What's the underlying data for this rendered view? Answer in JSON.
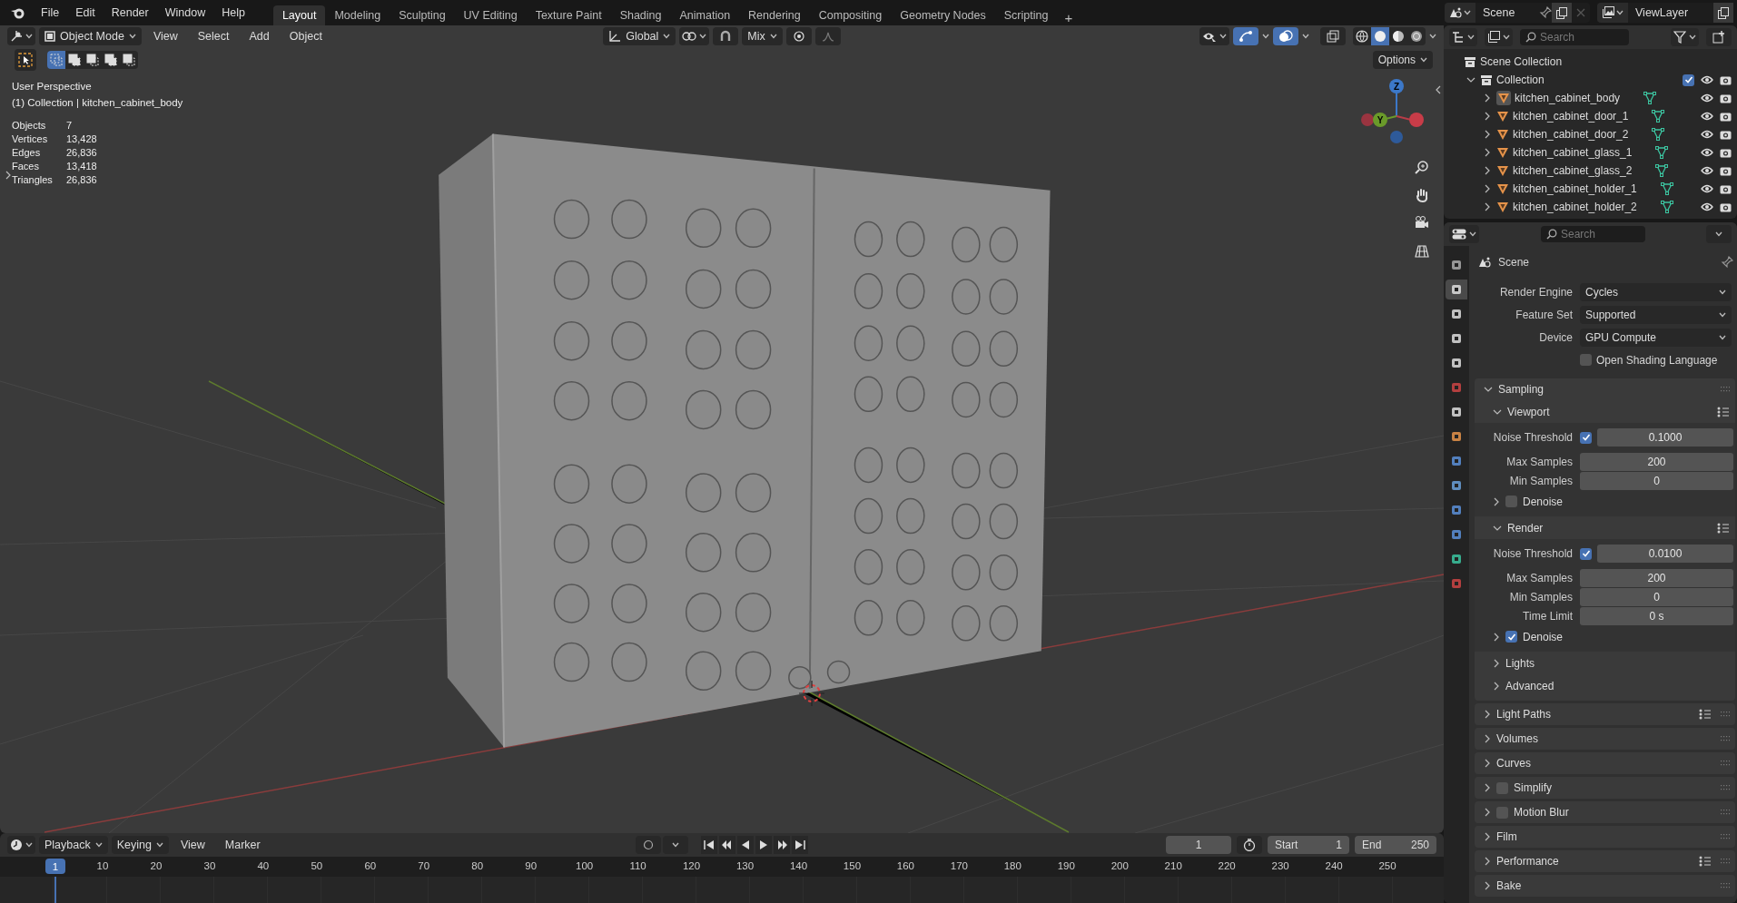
{
  "top_bar": {
    "menus": [
      "File",
      "Edit",
      "Render",
      "Window",
      "Help"
    ],
    "workspaces": [
      {
        "label": "Layout",
        "selected": true
      },
      {
        "label": "Modeling",
        "selected": false
      },
      {
        "label": "Sculpting",
        "selected": false
      },
      {
        "label": "UV Editing",
        "selected": false
      },
      {
        "label": "Texture Paint",
        "selected": false
      },
      {
        "label": "Shading",
        "selected": false
      },
      {
        "label": "Animation",
        "selected": false
      },
      {
        "label": "Rendering",
        "selected": false
      },
      {
        "label": "Compositing",
        "selected": false
      },
      {
        "label": "Geometry Nodes",
        "selected": false
      },
      {
        "label": "Scripting",
        "selected": false
      }
    ],
    "add_workspace": "+",
    "scene": "Scene",
    "view_layer": "ViewLayer"
  },
  "viewport": {
    "header": {
      "mode": "Object Mode",
      "menus": [
        "View",
        "Select",
        "Add",
        "Object"
      ],
      "orientation": "Global",
      "snap_target": "Mix",
      "options": "Options"
    },
    "select_modes": [
      {
        "selected": true
      },
      {
        "selected": false
      },
      {
        "selected": false
      },
      {
        "selected": false
      },
      {
        "selected": false
      }
    ],
    "gizmos_on": true,
    "overlays_on": true,
    "shading_modes": [
      {
        "selected": false
      },
      {
        "selected": true
      },
      {
        "selected": false
      },
      {
        "selected": false
      }
    ],
    "view_name": "User Perspective",
    "active_object": "(1) Collection | kitchen_cabinet_body",
    "statistics": [
      {
        "label": "Objects",
        "value": "7"
      },
      {
        "label": "Vertices",
        "value": "13,428"
      },
      {
        "label": "Edges",
        "value": "26,836"
      },
      {
        "label": "Faces",
        "value": "13,418"
      },
      {
        "label": "Triangles",
        "value": "26,836"
      }
    ],
    "axis_labels": [
      "Z",
      "Y"
    ]
  },
  "outliner": {
    "search_placeholder": "Search",
    "tree": [
      {
        "name": "Scene Collection",
        "kind": "scene_collection",
        "children": [
          {
            "name": "Collection",
            "kind": "collection",
            "expanded": true,
            "included": true,
            "children": [
              {
                "name": "kitchen_cabinet_body",
                "kind": "mesh",
                "expanded": false,
                "active": true
              },
              {
                "name": "kitchen_cabinet_door_1",
                "kind": "mesh",
                "expanded": false,
                "active": false
              },
              {
                "name": "kitchen_cabinet_door_2",
                "kind": "mesh",
                "expanded": false,
                "active": false
              },
              {
                "name": "kitchen_cabinet_glass_1",
                "kind": "mesh",
                "expanded": false,
                "active": false
              },
              {
                "name": "kitchen_cabinet_glass_2",
                "kind": "mesh",
                "expanded": false,
                "active": false
              },
              {
                "name": "kitchen_cabinet_holder_1",
                "kind": "mesh",
                "expanded": false,
                "active": false
              },
              {
                "name": "kitchen_cabinet_holder_2",
                "kind": "mesh",
                "expanded": false,
                "active": false
              }
            ]
          }
        ]
      }
    ]
  },
  "properties": {
    "search_placeholder": "Search",
    "tabs": [
      {
        "selected": false
      },
      {
        "selected": true
      },
      {
        "selected": false
      },
      {
        "selected": false
      },
      {
        "selected": false
      },
      {
        "selected": false
      },
      {
        "selected": false
      },
      {
        "selected": false
      },
      {
        "selected": false
      },
      {
        "selected": false
      },
      {
        "selected": false
      },
      {
        "selected": false
      },
      {
        "selected": false
      },
      {
        "selected": false
      }
    ],
    "context": "Scene",
    "fields": [
      {
        "kind": "dropdown",
        "label": "Render Engine",
        "value": "Cycles"
      },
      {
        "kind": "dropdown",
        "label": "Feature Set",
        "value": "Supported"
      },
      {
        "kind": "dropdown",
        "label": "Device",
        "value": "GPU Compute"
      },
      {
        "kind": "checkbox",
        "label": "Open Shading Language",
        "checked": false
      }
    ],
    "panels": [
      {
        "kind": "panel",
        "title": "Sampling",
        "expanded": true,
        "presets": false,
        "items": [
          {
            "kind": "panel",
            "title": "Viewport",
            "expanded": true,
            "presets": true,
            "items": [
              {
                "kind": "number",
                "label": "Noise Threshold",
                "checked": true,
                "value": "0.1000"
              },
              {
                "kind": "number",
                "label": "Max Samples",
                "value": "200"
              },
              {
                "kind": "number",
                "label": "Min Samples",
                "value": "0"
              },
              {
                "kind": "panel",
                "title": "Denoise",
                "expanded": false,
                "presets": false,
                "checked": false
              }
            ]
          },
          {
            "kind": "panel",
            "title": "Render",
            "expanded": true,
            "presets": true,
            "items": [
              {
                "kind": "number",
                "label": "Noise Threshold",
                "checked": true,
                "value": "0.0100"
              },
              {
                "kind": "number",
                "label": "Max Samples",
                "value": "200"
              },
              {
                "kind": "number",
                "label": "Min Samples",
                "value": "0"
              },
              {
                "kind": "number",
                "label": "Time Limit",
                "value": "0 s"
              },
              {
                "kind": "panel",
                "title": "Denoise",
                "expanded": false,
                "presets": false,
                "checked": true
              }
            ]
          },
          {
            "kind": "panel",
            "title": "Lights",
            "expanded": false,
            "presets": false
          },
          {
            "kind": "panel",
            "title": "Advanced",
            "expanded": false,
            "presets": false
          }
        ]
      },
      {
        "kind": "panel",
        "title": "Light Paths",
        "expanded": false,
        "presets": true
      },
      {
        "kind": "panel",
        "title": "Volumes",
        "expanded": false,
        "presets": false
      },
      {
        "kind": "panel",
        "title": "Curves",
        "expanded": false,
        "presets": false
      },
      {
        "kind": "panel",
        "title": "Simplify",
        "expanded": false,
        "presets": false,
        "checked": false
      },
      {
        "kind": "panel",
        "title": "Motion Blur",
        "expanded": false,
        "presets": false,
        "checked": false
      },
      {
        "kind": "panel",
        "title": "Film",
        "expanded": false,
        "presets": false
      },
      {
        "kind": "panel",
        "title": "Performance",
        "expanded": false,
        "presets": true
      },
      {
        "kind": "panel",
        "title": "Bake",
        "expanded": false,
        "presets": false
      }
    ]
  },
  "timeline": {
    "menus": [
      {
        "label": "Playback",
        "dropdown": true
      },
      {
        "label": "Keying",
        "dropdown": true
      },
      {
        "label": "View",
        "dropdown": false
      },
      {
        "label": "Marker",
        "dropdown": false
      }
    ],
    "current_frame": "1",
    "start_label": "Start",
    "start": "1",
    "end_label": "End",
    "end": "250",
    "playhead": "1",
    "ruler": [
      "10",
      "20",
      "30",
      "40",
      "50",
      "60",
      "70",
      "80",
      "90",
      "100",
      "110",
      "120",
      "130",
      "140",
      "150",
      "160",
      "170",
      "180",
      "190",
      "200",
      "210",
      "220",
      "230",
      "240",
      "250"
    ]
  }
}
